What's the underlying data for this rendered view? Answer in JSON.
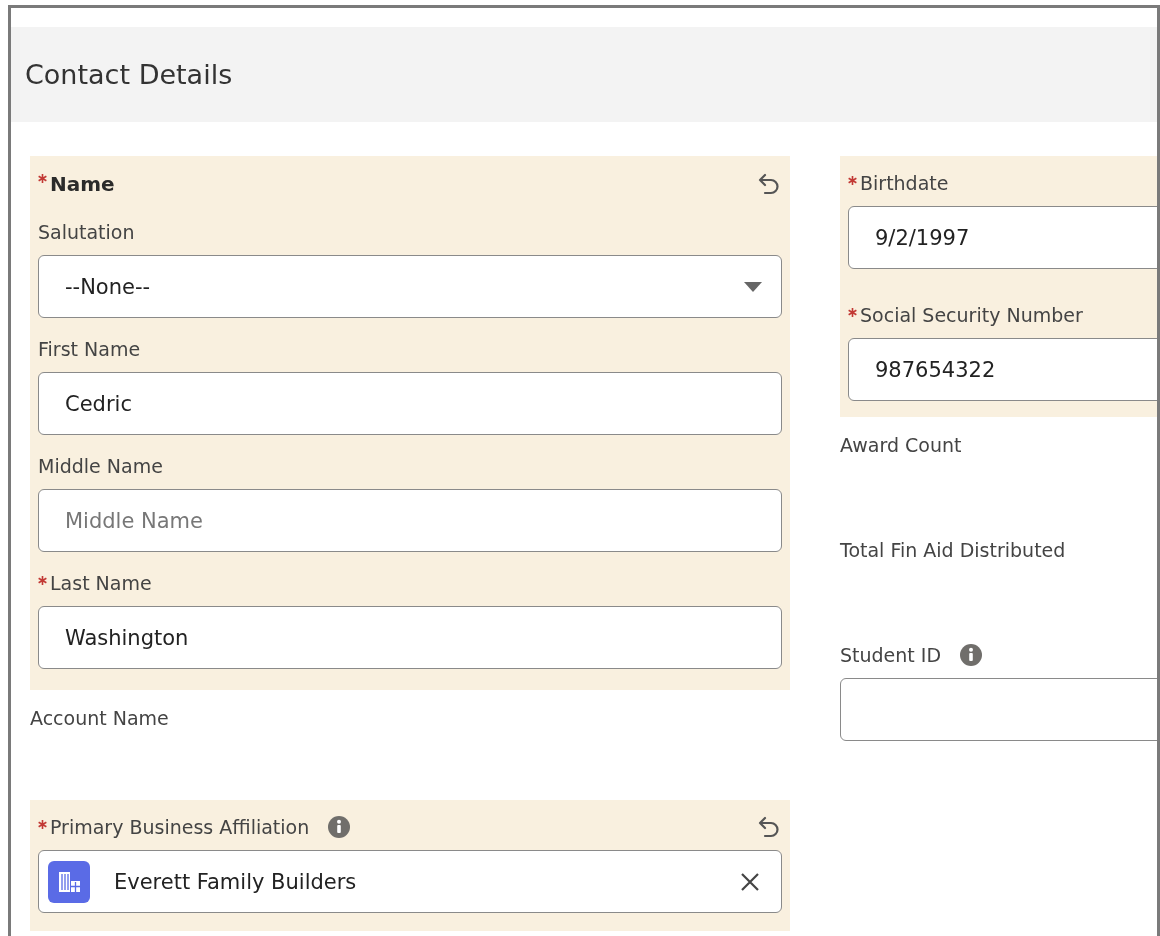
{
  "title": "Contact Details",
  "left": [
    {
      "kind": "group",
      "label": "Name",
      "required": true,
      "undo": true,
      "fields": [
        {
          "kind": "select",
          "label": "Salutation",
          "value": "--None--"
        },
        {
          "kind": "text",
          "label": "First Name",
          "value": "Cedric"
        },
        {
          "kind": "text",
          "label": "Middle Name",
          "placeholder": "Middle Name"
        },
        {
          "kind": "text",
          "label": "Last Name",
          "required": true,
          "value": "Washington"
        }
      ]
    },
    {
      "kind": "readonly",
      "label": "Account Name"
    },
    {
      "kind": "lookup",
      "label": "Primary Business Affiliation",
      "required": true,
      "info": true,
      "undo": true,
      "value": "Everett Family Builders"
    }
  ],
  "right": [
    {
      "kind": "group",
      "fields": [
        {
          "kind": "text",
          "label": "Birthdate",
          "required": true,
          "value": "9/2/1997"
        },
        {
          "kind": "text",
          "label": "Social Security Number",
          "required": true,
          "value": "987654322"
        }
      ]
    },
    {
      "kind": "readonly",
      "label": "Award Count"
    },
    {
      "kind": "readonly",
      "label": "Total Fin Aid Distributed"
    },
    {
      "kind": "text",
      "label": "Student ID",
      "info": true
    }
  ]
}
